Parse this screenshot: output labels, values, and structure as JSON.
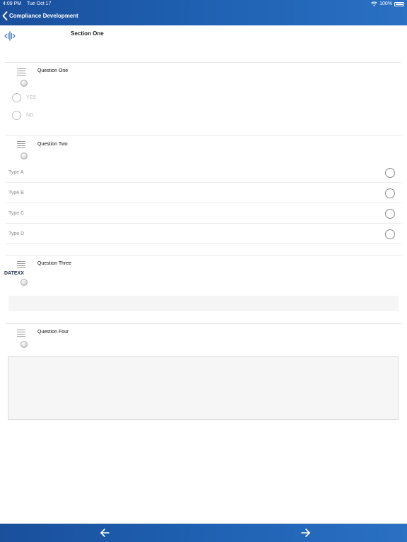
{
  "status_bar": {
    "time": "4:09 PM",
    "date": "Tue Oct 17",
    "battery": "100%"
  },
  "nav": {
    "title": "Compliance Development"
  },
  "section": {
    "title": "Section One"
  },
  "questions": [
    {
      "label": "Question One",
      "options": [
        "YES",
        "NO"
      ]
    },
    {
      "label": "Question Two",
      "options": [
        "Type A",
        "Type B",
        "Type C",
        "Type D"
      ]
    },
    {
      "label": "Question Three",
      "tag": "DATEXX"
    },
    {
      "label": "Question Four"
    }
  ],
  "icons": {
    "back": "chevron-left-icon",
    "section": "expand-horizontal-icon",
    "question": "list-icon",
    "status": "status-dot-icon",
    "prev": "arrow-left-icon",
    "next": "arrow-right-icon",
    "wifi": "wifi-icon",
    "battery": "battery-icon"
  },
  "colors": {
    "header": "#1e5fb0",
    "footer": "#1e5fb0",
    "accent": "#2f6fc0"
  }
}
